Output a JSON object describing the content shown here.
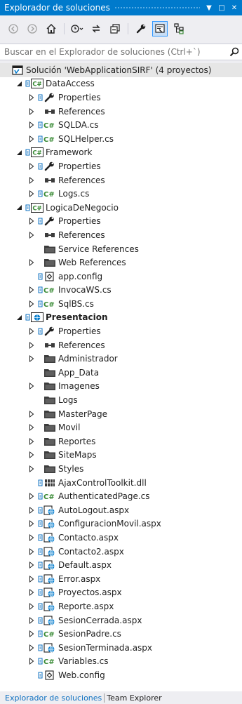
{
  "window": {
    "title": "Explorador de soluciones",
    "dropdown_glyph": "▼",
    "pin_glyph": "□",
    "close_glyph": "✕"
  },
  "toolbar": {
    "buttons": [
      "back-icon",
      "forward-icon",
      "home-icon",
      "history-icon",
      "sync-icon",
      "collapse-all-icon",
      "properties-icon",
      "preview-icon",
      "solution-view-icon"
    ]
  },
  "search": {
    "placeholder": "Buscar en el Explorador de soluciones (Ctrl+`)"
  },
  "colors": {
    "accent": "#007acc",
    "folder": "#3c3c3c",
    "csharp": "#388a34",
    "vcs": "#0e70c0",
    "wrench": "#212121"
  },
  "tree": [
    {
      "label": "Solución 'WebApplicationSIRF'  (4 proyectos)",
      "icon": "solution",
      "level": 0,
      "expander": "none",
      "selected": true,
      "badge": false,
      "bold": false
    },
    {
      "label": "DataAccess",
      "icon": "csproj",
      "level": 1,
      "expander": "expanded",
      "badge": true,
      "bold": false
    },
    {
      "label": "Properties",
      "icon": "wrench",
      "level": 2,
      "expander": "collapsed",
      "badge": true,
      "bold": false
    },
    {
      "label": "References",
      "icon": "references",
      "level": 2,
      "expander": "collapsed",
      "badge": false,
      "bold": false
    },
    {
      "label": "SQLDA.cs",
      "icon": "csfile",
      "level": 2,
      "expander": "collapsed",
      "badge": true,
      "bold": false
    },
    {
      "label": "SQLHelper.cs",
      "icon": "csfile",
      "level": 2,
      "expander": "collapsed",
      "badge": true,
      "bold": false
    },
    {
      "label": "Framework",
      "icon": "csproj",
      "level": 1,
      "expander": "expanded",
      "badge": true,
      "bold": false
    },
    {
      "label": "Properties",
      "icon": "wrench",
      "level": 2,
      "expander": "collapsed",
      "badge": true,
      "bold": false
    },
    {
      "label": "References",
      "icon": "references",
      "level": 2,
      "expander": "collapsed",
      "badge": false,
      "bold": false
    },
    {
      "label": "Logs.cs",
      "icon": "csfile",
      "level": 2,
      "expander": "collapsed",
      "badge": true,
      "bold": false
    },
    {
      "label": "LogicaDeNegocio",
      "icon": "csproj",
      "level": 1,
      "expander": "expanded",
      "badge": true,
      "bold": false
    },
    {
      "label": "Properties",
      "icon": "wrench",
      "level": 2,
      "expander": "collapsed",
      "badge": true,
      "bold": false
    },
    {
      "label": "References",
      "icon": "references",
      "level": 2,
      "expander": "collapsed",
      "badge": false,
      "bold": false
    },
    {
      "label": "Service References",
      "icon": "folder",
      "level": 2,
      "expander": "none",
      "badge": false,
      "bold": false
    },
    {
      "label": "Web References",
      "icon": "folder",
      "level": 2,
      "expander": "collapsed",
      "badge": false,
      "bold": false
    },
    {
      "label": "app.config",
      "icon": "config",
      "level": 2,
      "expander": "none",
      "badge": true,
      "bold": false
    },
    {
      "label": "InvocaWS.cs",
      "icon": "csfile",
      "level": 2,
      "expander": "collapsed",
      "badge": true,
      "bold": false
    },
    {
      "label": "SqlBS.cs",
      "icon": "csfile",
      "level": 2,
      "expander": "collapsed",
      "badge": true,
      "bold": false
    },
    {
      "label": "Presentacion",
      "icon": "webproj",
      "level": 1,
      "expander": "expanded",
      "badge": true,
      "bold": true
    },
    {
      "label": "Properties",
      "icon": "wrench",
      "level": 2,
      "expander": "collapsed",
      "badge": true,
      "bold": false
    },
    {
      "label": "References",
      "icon": "references",
      "level": 2,
      "expander": "collapsed",
      "badge": false,
      "bold": false
    },
    {
      "label": "Administrador",
      "icon": "folder",
      "level": 2,
      "expander": "collapsed",
      "badge": false,
      "bold": false
    },
    {
      "label": "App_Data",
      "icon": "folder",
      "level": 2,
      "expander": "none",
      "badge": false,
      "bold": false
    },
    {
      "label": "Imagenes",
      "icon": "folder",
      "level": 2,
      "expander": "collapsed",
      "badge": false,
      "bold": false
    },
    {
      "label": "Logs",
      "icon": "folder",
      "level": 2,
      "expander": "none",
      "badge": false,
      "bold": false
    },
    {
      "label": "MasterPage",
      "icon": "folder",
      "level": 2,
      "expander": "collapsed",
      "badge": false,
      "bold": false
    },
    {
      "label": "Movil",
      "icon": "folder",
      "level": 2,
      "expander": "collapsed",
      "badge": false,
      "bold": false
    },
    {
      "label": "Reportes",
      "icon": "folder",
      "level": 2,
      "expander": "collapsed",
      "badge": false,
      "bold": false
    },
    {
      "label": "SiteMaps",
      "icon": "folder",
      "level": 2,
      "expander": "collapsed",
      "badge": false,
      "bold": false
    },
    {
      "label": "Styles",
      "icon": "folder",
      "level": 2,
      "expander": "collapsed",
      "badge": false,
      "bold": false
    },
    {
      "label": "AjaxControlToolkit.dll",
      "icon": "dll",
      "level": 2,
      "expander": "none",
      "badge": true,
      "bold": false
    },
    {
      "label": "AuthenticatedPage.cs",
      "icon": "csfile",
      "level": 2,
      "expander": "collapsed",
      "badge": true,
      "bold": false
    },
    {
      "label": "AutoLogout.aspx",
      "icon": "aspx",
      "level": 2,
      "expander": "collapsed",
      "badge": true,
      "bold": false
    },
    {
      "label": "ConfiguracionMovil.aspx",
      "icon": "aspx",
      "level": 2,
      "expander": "collapsed",
      "badge": true,
      "bold": false
    },
    {
      "label": "Contacto.aspx",
      "icon": "aspx",
      "level": 2,
      "expander": "collapsed",
      "badge": true,
      "bold": false
    },
    {
      "label": "Contacto2.aspx",
      "icon": "aspx",
      "level": 2,
      "expander": "collapsed",
      "badge": true,
      "bold": false
    },
    {
      "label": "Default.aspx",
      "icon": "aspx",
      "level": 2,
      "expander": "collapsed",
      "badge": true,
      "bold": false
    },
    {
      "label": "Error.aspx",
      "icon": "aspx",
      "level": 2,
      "expander": "collapsed",
      "badge": true,
      "bold": false
    },
    {
      "label": "Proyectos.aspx",
      "icon": "aspx",
      "level": 2,
      "expander": "collapsed",
      "badge": true,
      "bold": false
    },
    {
      "label": "Reporte.aspx",
      "icon": "aspx",
      "level": 2,
      "expander": "collapsed",
      "badge": true,
      "bold": false
    },
    {
      "label": "SesionCerrada.aspx",
      "icon": "aspx",
      "level": 2,
      "expander": "collapsed",
      "badge": true,
      "bold": false
    },
    {
      "label": "SesionPadre.cs",
      "icon": "csfile",
      "level": 2,
      "expander": "collapsed",
      "badge": true,
      "bold": false
    },
    {
      "label": "SesionTerminada.aspx",
      "icon": "aspx",
      "level": 2,
      "expander": "collapsed",
      "badge": true,
      "bold": false
    },
    {
      "label": "Variables.cs",
      "icon": "csfile",
      "level": 2,
      "expander": "collapsed",
      "badge": true,
      "bold": false
    },
    {
      "label": "Web.config",
      "icon": "config",
      "level": 2,
      "expander": "none",
      "badge": true,
      "bold": false
    }
  ],
  "bottom_tabs": [
    {
      "label": "Explorador de soluciones",
      "active": true
    },
    {
      "label": "Team Explorer",
      "active": false
    }
  ]
}
